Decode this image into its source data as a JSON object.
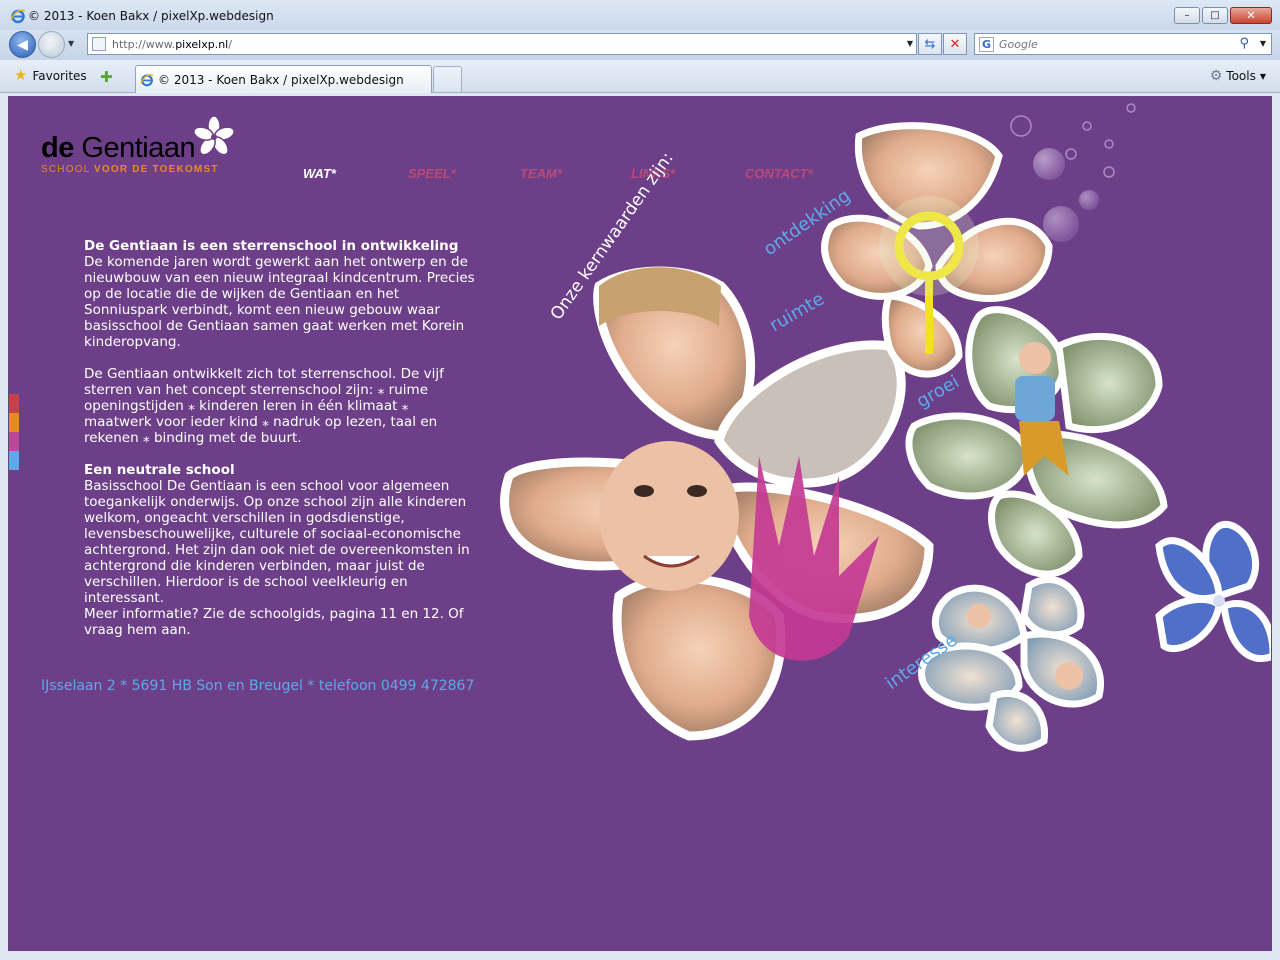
{
  "window": {
    "title": "© 2013 - Koen Bakx / pixelXp.webdesign",
    "buttons": {
      "minimize": "–",
      "maximize": "□",
      "close": "✕"
    }
  },
  "navbar": {
    "address": {
      "prefix": "http://www.",
      "host": "pixelxp.nl",
      "suffix": "/"
    },
    "search_placeholder": "Google"
  },
  "favbar": {
    "favorites_label": "Favorites",
    "tab_title": "© 2013 - Koen Bakx / pixelXp.webdesign",
    "tools_label": "Tools"
  },
  "site": {
    "logo": {
      "word_bold": "de",
      "word_rest": " Gentiaan",
      "tag_thin": "SCHOOL ",
      "tag_bold": "VOOR DE TOEKOMST"
    },
    "nav": [
      {
        "label": "WAT*",
        "active": true
      },
      {
        "label": "SPEEL*",
        "active": false
      },
      {
        "label": "TEAM*",
        "active": false
      },
      {
        "label": "LINKS*",
        "active": false
      },
      {
        "label": "CONTACT*",
        "active": false
      }
    ],
    "sections": [
      {
        "heading": "De Gentiaan is een sterrenschool in ontwikkeling",
        "body": "De komende jaren wordt gewerkt aan het ontwerp en de nieuwbouw van een nieuw integraal kindcentrum. Precies op de locatie die de wijken de Gentiaan en het Sonniuspark verbindt, komt een nieuw gebouw waar basisschool de Gentiaan samen gaat werken met Korein kinderopvang."
      },
      {
        "heading": "",
        "body": "De Gentiaan ontwikkelt zich tot sterrenschool. De vijf sterren van het concept sterrenschool zijn: ⁎ ruime openingstijden ⁎ kinderen leren in één klimaat ⁎ maatwerk voor ieder kind ⁎ nadruk op lezen, taal en rekenen ⁎ binding met de buurt."
      },
      {
        "heading": "Een neutrale school",
        "body": "Basisschool De Gentiaan is een school voor algemeen toegankelijk onderwijs. Op onze school zijn alle kinderen welkom, ongeacht verschillen in godsdienstige, levensbeschouwelijke, culturele of sociaal-economische achtergrond. Het zijn dan ook niet de overeenkomsten in achtergrond die kinderen verbinden, maar juist de verschillen. Hierdoor is de school veelkleurig en interessant.",
        "extra": "Meer informatie? Zie de schoolgids, pagina 11 en 12. Of vraag hem aan."
      }
    ],
    "address": "IJsselaan 2 * 5691 HB Son en Breugel * telefoon 0499 472867",
    "art_labels": {
      "intro": "Onze kernwaarden zijn:",
      "values": [
        "ontdekking",
        "ruimte",
        "groei",
        "interesse"
      ]
    },
    "colors": {
      "background": "#6d3f88",
      "nav_inactive": "#b84a78",
      "logo_tag": "#e9872b",
      "address": "#5da9e9",
      "sidebar": [
        "#c8404a",
        "#e9872b",
        "#b84a9a",
        "#5da9e9"
      ]
    }
  }
}
